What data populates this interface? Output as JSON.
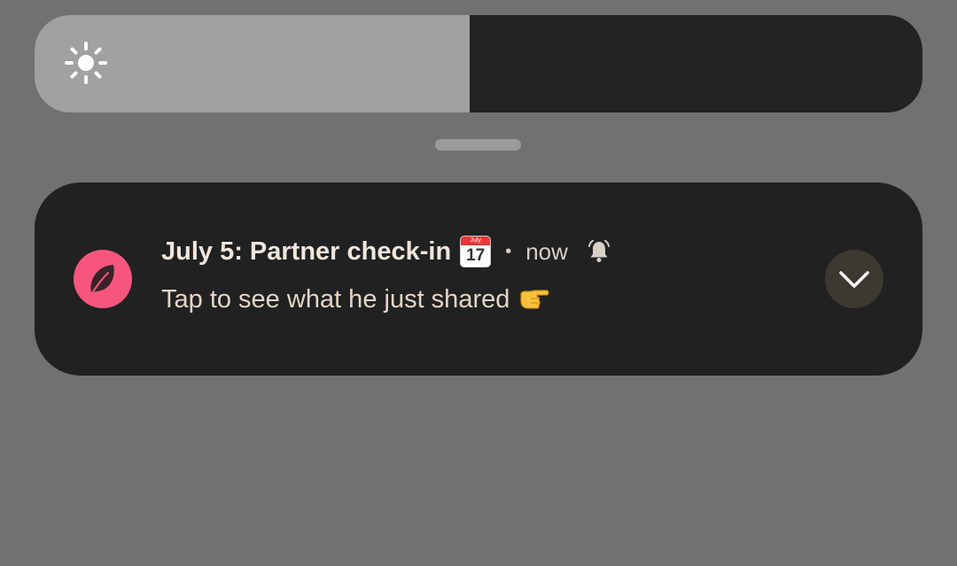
{
  "brightness": {
    "level": 0.49,
    "icon": "sun-icon"
  },
  "notification": {
    "app_icon": "feather-icon",
    "app_icon_color": "#f6567e",
    "title": "July 5: Partner check-in",
    "title_emoji": "calendar-emoji",
    "calendar_month": "July",
    "calendar_day": "17",
    "separator": "•",
    "time": "now",
    "alert_icon": "ringing-bell-icon",
    "body": "Tap to see what he just shared",
    "body_emoji": "pointing-right-emoji",
    "expand_icon": "chevron-down-icon"
  }
}
